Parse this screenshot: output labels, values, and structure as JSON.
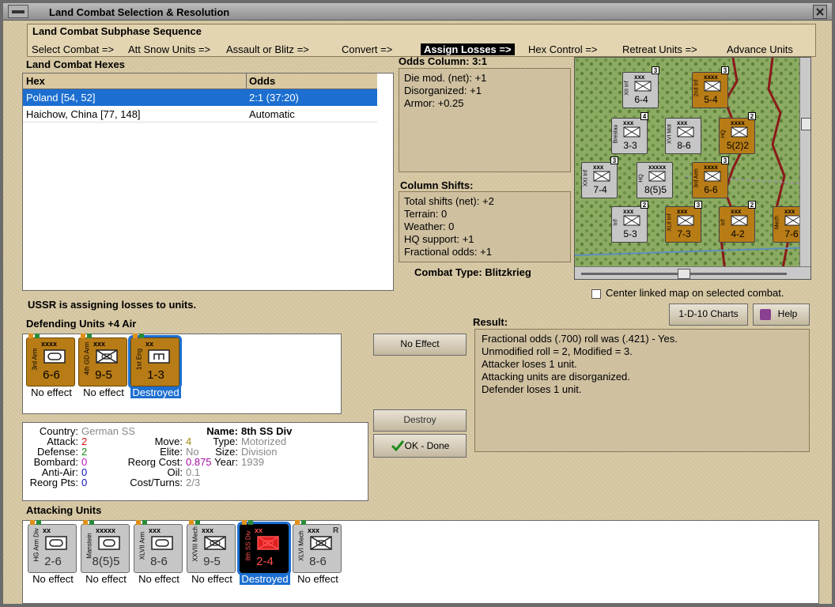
{
  "window": {
    "title": "Land Combat Selection & Resolution"
  },
  "subphase": {
    "title": "Land Combat Subphase Sequence",
    "steps": [
      "Select Combat =>",
      "Att Snow Units =>",
      "Assault or Blitz =>",
      "Convert =>",
      "Assign Losses =>",
      "Hex Control =>",
      "Retreat Units =>",
      "Advance Units"
    ],
    "selected_index": 4
  },
  "hexes": {
    "title": "Land Combat Hexes",
    "columns": [
      "Hex",
      "Odds"
    ],
    "rows": [
      {
        "hex": "Poland [54, 52]",
        "odds": "2:1 (37:20)"
      },
      {
        "hex": "Haichow, China [77, 148]",
        "odds": "Automatic"
      }
    ],
    "selected_row": 0
  },
  "odds": {
    "title": "Odds Column: 3:1",
    "lines": [
      "Die mod. (net): +1",
      "Disorganized: +1",
      "Armor: +0.25"
    ]
  },
  "shifts": {
    "title": "Column Shifts:",
    "lines": [
      "Total shifts (net): +2",
      "Terrain: 0",
      "Weather: 0",
      "HQ support: +1",
      "Fractional odds: +1"
    ]
  },
  "combat_type": "Combat Type:  Blitzkrieg",
  "center_linked": {
    "label": "Center linked map on selected combat.",
    "checked": false
  },
  "status_message": "USSR is assigning losses to units.",
  "defending": {
    "title": "Defending Units +4 Air",
    "units": [
      {
        "name": "3rd Arm",
        "size": "xxxx",
        "value": "6-6",
        "status": "No effect",
        "color": "german",
        "symbol": "armor"
      },
      {
        "name": "4th GD Arm",
        "size": "xxx",
        "value": "9-5",
        "status": "No effect",
        "color": "german",
        "symbol": "mech"
      },
      {
        "name": "1st Eng",
        "size": "xx",
        "value": "1-3",
        "status": "Destroyed",
        "color": "german",
        "symbol": "engineer"
      }
    ],
    "selected_index": 2
  },
  "buttons": {
    "no_effect": "No Effect",
    "destroy": "Destroy",
    "ok_done": "OK - Done",
    "charts": "1-D-10 Charts",
    "help": "Help"
  },
  "result": {
    "title": "Result:",
    "lines": [
      "Fractional odds (.700) roll was (.421)  - Yes.",
      "Unmodified roll = 2, Modified = 3.",
      "Attacker loses 1 unit.",
      "Attacking units are disorganized.",
      "Defender loses 1 unit."
    ]
  },
  "details": {
    "country_label": "Country:",
    "country": "German SS",
    "attack_label": "Attack:",
    "attack": "2",
    "defense_label": "Defense:",
    "defense": "2",
    "bombard_label": "Bombard:",
    "bombard": "0",
    "antiair_label": "Anti-Air:",
    "antiair": "0",
    "reorgpts_label": "Reorg Pts:",
    "reorgpts": "0",
    "move_label": "Move:",
    "move": "4",
    "elite_label": "Elite:",
    "elite": "No",
    "reorgcost_label": "Reorg Cost:",
    "reorgcost": "0.875",
    "oil_label": "Oil:",
    "oil": "0.1",
    "costturns_label": "Cost/Turns:",
    "costturns": "2/3",
    "name_label": "Name:",
    "name": "8th SS Div",
    "type_label": "Type:",
    "type": "Motorized",
    "sizef_label": "Size:",
    "sizef": "Division",
    "year_label": "Year:",
    "year": "1939"
  },
  "attacking": {
    "title": "Attacking Units",
    "units": [
      {
        "name": "HG Arm Div",
        "size": "xx",
        "value": "2-6",
        "status": "No effect",
        "color": "grey",
        "symbol": "armor"
      },
      {
        "name": "Manstein",
        "size": "xxxxx",
        "value": "8(5)5",
        "status": "No effect",
        "color": "grey",
        "symbol": "hq"
      },
      {
        "name": "XLVII Arm",
        "size": "xxx",
        "value": "8-6",
        "status": "No effect",
        "color": "grey",
        "symbol": "armor"
      },
      {
        "name": "XXVIII Mech",
        "size": "xxx",
        "value": "9-5",
        "status": "No effect",
        "color": "grey",
        "symbol": "mech"
      },
      {
        "name": "8th SS Div",
        "size": "xx",
        "value": "2-4",
        "status": "Destroyed",
        "color": "black",
        "symbol": "mech"
      },
      {
        "name": "XLVI Mech",
        "size": "xxx",
        "value": "8-6",
        "status": "No effect",
        "color": "grey",
        "symbol": "mech",
        "mark": "R"
      }
    ],
    "selected_index": 4
  },
  "map": {
    "counters": [
      {
        "size": "xxx",
        "value": "6-4",
        "color": "grey",
        "num": "3",
        "name": "XII Inf"
      },
      {
        "size": "xxxx",
        "value": "5-4",
        "color": "german",
        "num": "3",
        "name": "2nd Inf"
      },
      {
        "size": "xxx",
        "value": "3-3",
        "color": "grey",
        "num": "4",
        "name": "Breslau"
      },
      {
        "size": "xxx",
        "value": "8-6",
        "color": "grey",
        "num": "",
        "name": "XVI Mot"
      },
      {
        "size": "xxxx",
        "value": "5(2)2",
        "color": "german",
        "num": "2",
        "name": "HQ"
      },
      {
        "size": "xxx",
        "value": "7-4",
        "color": "grey",
        "num": "3",
        "name": "XXI Inf"
      },
      {
        "size": "xxxxx",
        "value": "8(5)5",
        "color": "grey",
        "num": "",
        "name": "HQ"
      },
      {
        "size": "xxxx",
        "value": "6-6",
        "color": "german",
        "num": "3",
        "name": "3rd Arm"
      },
      {
        "size": "xxx",
        "value": "5-3",
        "color": "grey",
        "num": "2",
        "name": "Inf"
      },
      {
        "size": "xxx",
        "value": "7-3",
        "color": "german",
        "num": "3",
        "name": "XLII Inf"
      },
      {
        "size": "xxx",
        "value": "4-2",
        "color": "german",
        "num": "2",
        "name": "Inf"
      },
      {
        "size": "xxx",
        "value": "7-6",
        "color": "german",
        "num": "",
        "name": "Mech"
      }
    ]
  }
}
